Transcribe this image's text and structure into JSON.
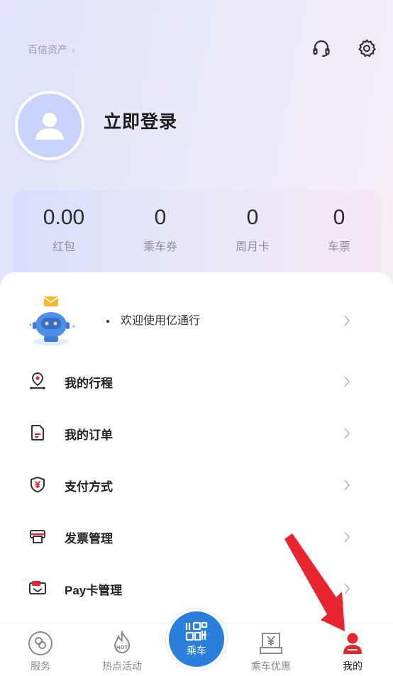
{
  "header": {
    "asset_link": "百信资产",
    "login_text": "立即登录"
  },
  "icons": {
    "headset": "headset-icon",
    "settings": "gear-icon",
    "avatar": "user-avatar-icon"
  },
  "stats": [
    {
      "value": "0.00",
      "label": "红包"
    },
    {
      "value": "0",
      "label": "乘车券"
    },
    {
      "value": "0",
      "label": "周月卡"
    },
    {
      "value": "0",
      "label": "车票"
    }
  ],
  "welcome": {
    "text": "欢迎使用亿通行"
  },
  "menu": [
    {
      "label": "我的行程",
      "icon": "location-route-icon"
    },
    {
      "label": "我的订单",
      "icon": "order-document-icon"
    },
    {
      "label": "支付方式",
      "icon": "payment-shield-icon"
    },
    {
      "label": "发票管理",
      "icon": "invoice-printer-icon"
    },
    {
      "label": "Pay卡管理",
      "icon": "pay-card-icon"
    }
  ],
  "tabbar": {
    "tabs": [
      {
        "label": "服务",
        "icon": "service-icon"
      },
      {
        "label": "热点活动",
        "icon": "hot-flame-icon"
      },
      {
        "label": "乘车",
        "icon": "qr-code-icon"
      },
      {
        "label": "乘车优惠",
        "icon": "coupon-yen-icon"
      },
      {
        "label": "我的",
        "icon": "user-icon"
      }
    ]
  },
  "colors": {
    "accent_blue": "#2a7fda",
    "accent_red": "#e8242f",
    "annotation_arrow": "#e8242f"
  }
}
